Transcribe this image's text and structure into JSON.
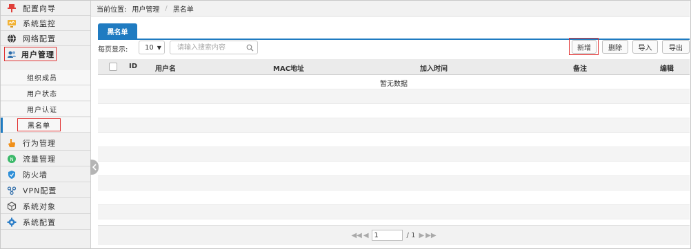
{
  "sidebar": {
    "items": [
      {
        "label": "配置向导",
        "icon": "pushpin-icon"
      },
      {
        "label": "系统监控",
        "icon": "monitor-icon"
      },
      {
        "label": "网络配置",
        "icon": "globe-icon"
      },
      {
        "label": "用户管理",
        "icon": "users-icon"
      },
      {
        "label": "行为管理",
        "icon": "hand-pointer-icon"
      },
      {
        "label": "流量管理",
        "icon": "traffic-icon"
      },
      {
        "label": "防火墙",
        "icon": "shield-icon"
      },
      {
        "label": "VPN配置",
        "icon": "vpn-icon"
      },
      {
        "label": "系统对象",
        "icon": "cube-icon"
      },
      {
        "label": "系统配置",
        "icon": "gear-icon"
      }
    ],
    "sub_items": [
      {
        "label": "组织成员"
      },
      {
        "label": "用户状态"
      },
      {
        "label": "用户认证"
      },
      {
        "label": "黑名单"
      }
    ]
  },
  "breadcrumb": {
    "prefix": "当前位置:",
    "level1": "用户管理",
    "separator": "/",
    "level2": "黑名单"
  },
  "tabs": [
    {
      "label": "黑名单"
    }
  ],
  "toolbar": {
    "per_page_label": "每页显示:",
    "per_page_value": "10",
    "search_placeholder": "请输入搜索内容",
    "add_label": "新增",
    "delete_label": "删除",
    "import_label": "导入",
    "export_label": "导出"
  },
  "table": {
    "columns": [
      "ID",
      "用户名",
      "MAC地址",
      "加入时间",
      "备注",
      "编辑"
    ],
    "empty_text": "暂无数据"
  },
  "pager": {
    "current_page": "1",
    "total": "/ 1"
  },
  "colors": {
    "accent": "#1f7bc1",
    "highlight_border": "#e03030"
  }
}
